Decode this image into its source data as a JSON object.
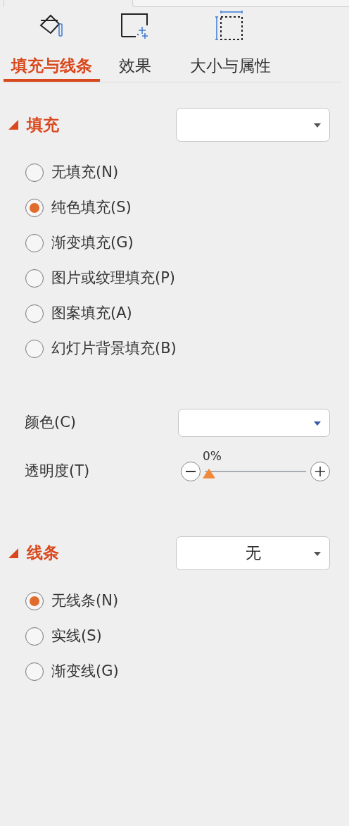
{
  "tabs": [
    {
      "label": "填充与线条",
      "selected": true
    },
    {
      "label": "效果",
      "selected": false
    },
    {
      "label": "大小与属性",
      "selected": false
    }
  ],
  "fill": {
    "title": "填充",
    "expanded": true,
    "options": [
      {
        "label": "无填充(N)",
        "selected": false
      },
      {
        "label": "纯色填充(S)",
        "selected": true
      },
      {
        "label": "渐变填充(G)",
        "selected": false
      },
      {
        "label": "图片或纹理填充(P)",
        "selected": false
      },
      {
        "label": "图案填充(A)",
        "selected": false
      },
      {
        "label": "幻灯片背景填充(B)",
        "selected": false
      }
    ],
    "color": {
      "label": "颜色(C)"
    },
    "transparency": {
      "label": "透明度(T)",
      "reading": "0%",
      "level": 0
    }
  },
  "line": {
    "title": "线条",
    "expanded": true,
    "dropdown_value": "无",
    "options": [
      {
        "label": "无线条(N)",
        "selected": true
      },
      {
        "label": "实线(S)",
        "selected": false
      },
      {
        "label": "渐变线(G)",
        "selected": false
      }
    ]
  }
}
